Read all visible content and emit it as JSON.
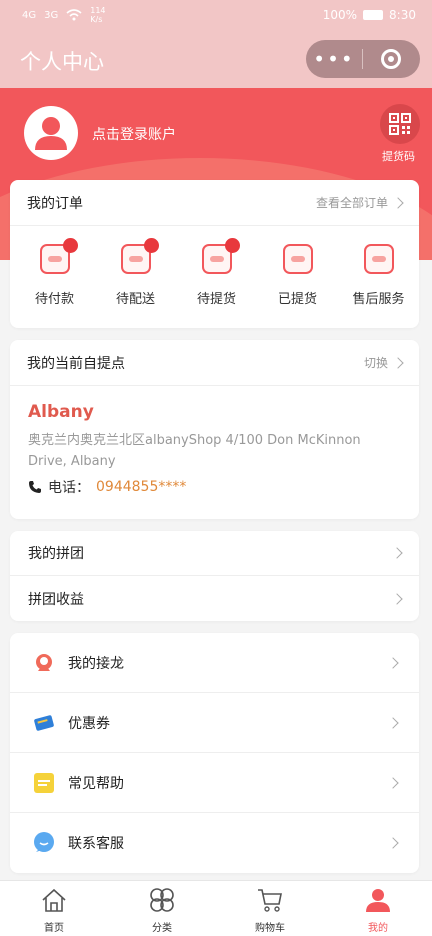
{
  "status_bar": {
    "signal1": "4G",
    "signal2": "3G",
    "speed": "114",
    "speed_unit": "K/s",
    "battery": "100%",
    "time": "8:30"
  },
  "header": {
    "title": "个人中心"
  },
  "profile": {
    "login_text": "点击登录账户",
    "qr_label": "提货码"
  },
  "orders": {
    "title": "我的订单",
    "view_all": "查看全部订单",
    "items": [
      {
        "label": "待付款",
        "icon": "wallet-icon"
      },
      {
        "label": "待配送",
        "icon": "delivery-truck-icon"
      },
      {
        "label": "待提货",
        "icon": "pickup-basket-icon"
      },
      {
        "label": "已提货",
        "icon": "received-check-icon"
      },
      {
        "label": "售后服务",
        "icon": "after-sales-yuan-icon"
      }
    ]
  },
  "pickup": {
    "title": "我的当前自提点",
    "switch": "切换",
    "name": "Albany",
    "address": "奥克兰内奥克兰北区albanyShop 4/100 Don McKinnon Drive, Albany",
    "phone_label": "电话：",
    "phone": "0944855****"
  },
  "group": {
    "rows": [
      {
        "label": "我的拼团"
      },
      {
        "label": "拼团收益"
      }
    ]
  },
  "menu": {
    "rows": [
      {
        "label": "我的接龙",
        "icon": "solitaire-icon"
      },
      {
        "label": "优惠券",
        "icon": "coupon-icon"
      },
      {
        "label": "常见帮助",
        "icon": "help-note-icon"
      },
      {
        "label": "联系客服",
        "icon": "chat-bubble-icon"
      }
    ]
  },
  "tabbar": {
    "items": [
      {
        "label": "首页",
        "icon": "home-icon"
      },
      {
        "label": "分类",
        "icon": "category-icon"
      },
      {
        "label": "购物车",
        "icon": "cart-icon"
      },
      {
        "label": "我的",
        "icon": "user-icon"
      }
    ]
  },
  "colors": {
    "brand_red": "#f2575b",
    "topbar_pink": "#f2c6c6",
    "phone_orange": "#e0893a"
  }
}
